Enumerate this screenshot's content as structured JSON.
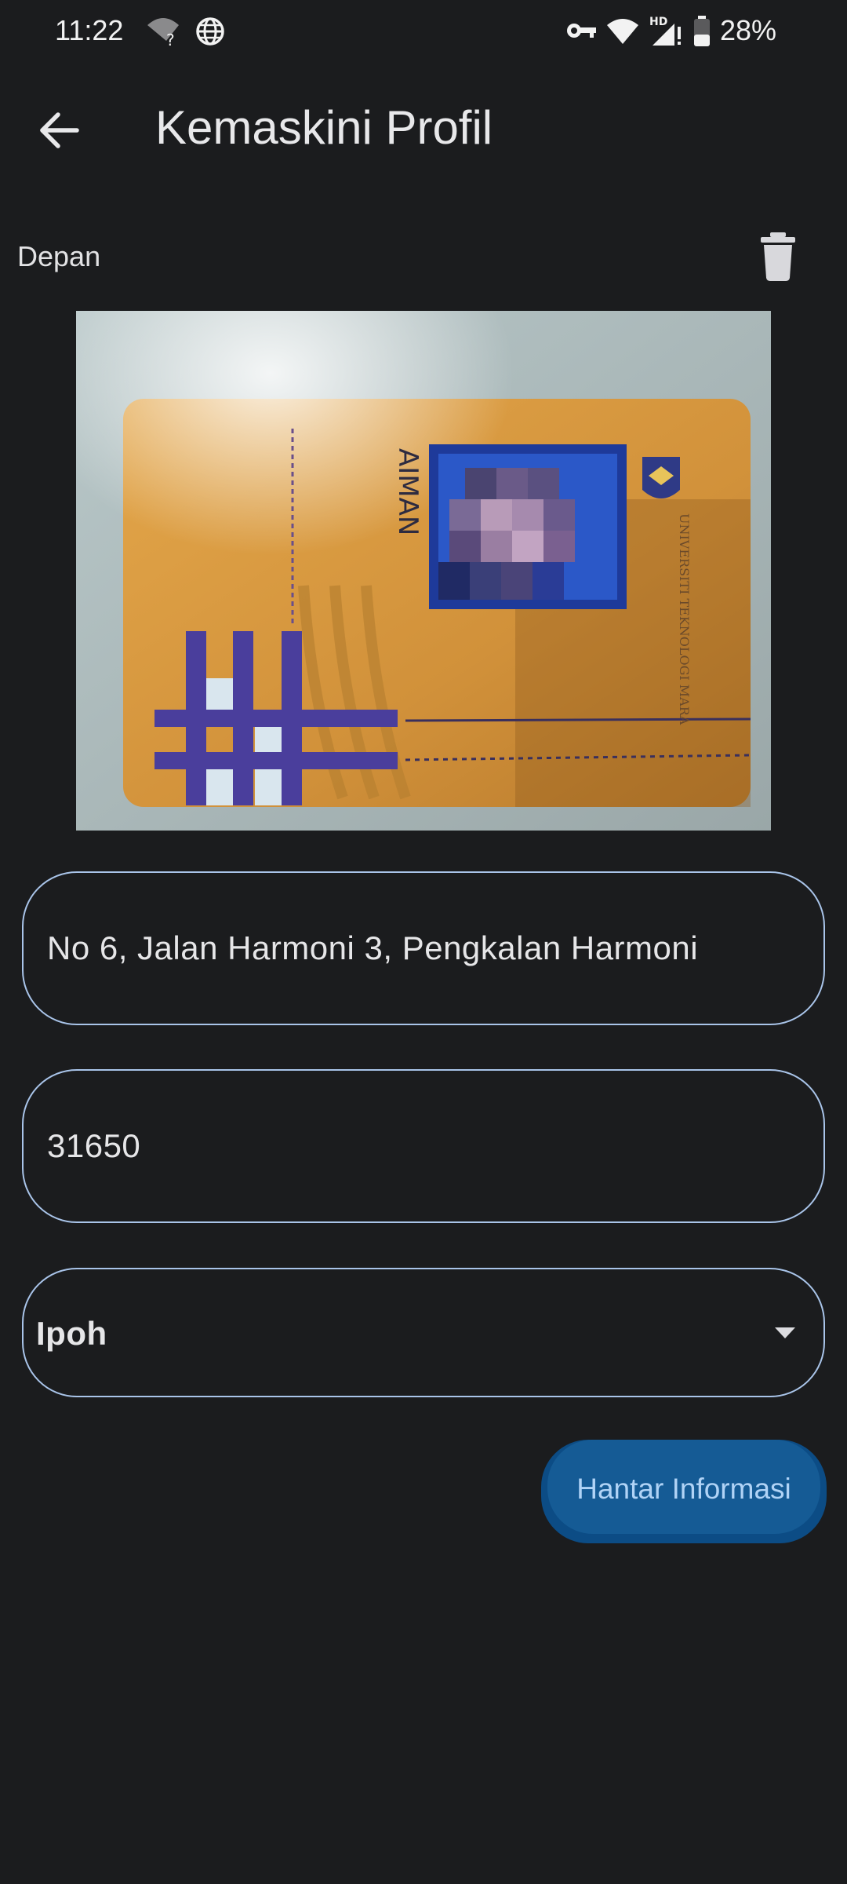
{
  "status_bar": {
    "time": "11:22",
    "battery": "28%",
    "icons": [
      "wifi-question-icon",
      "globe-icon",
      "vpn-key-icon",
      "wifi-icon",
      "signal-hd-icon",
      "battery-icon"
    ]
  },
  "app_bar": {
    "back_icon": "arrow-back-icon",
    "title": "Kemaskini Profil"
  },
  "photo_section": {
    "label": "Depan",
    "delete_icon": "trash-icon",
    "card_name": "AIMAN",
    "card_institution": "UNIVERSITI TEKNOLOGI MARA"
  },
  "form": {
    "address_value": "No 6, Jalan Harmoni 3, Pengkalan Harmoni",
    "postcode_value": "31650",
    "city_selected": "Ipoh",
    "submit_label": "Hantar Informasi"
  },
  "colors": {
    "background": "#1b1c1e",
    "field_border": "#a9c4e9",
    "button_bg": "#155b95",
    "button_text": "#b0d3f6"
  }
}
